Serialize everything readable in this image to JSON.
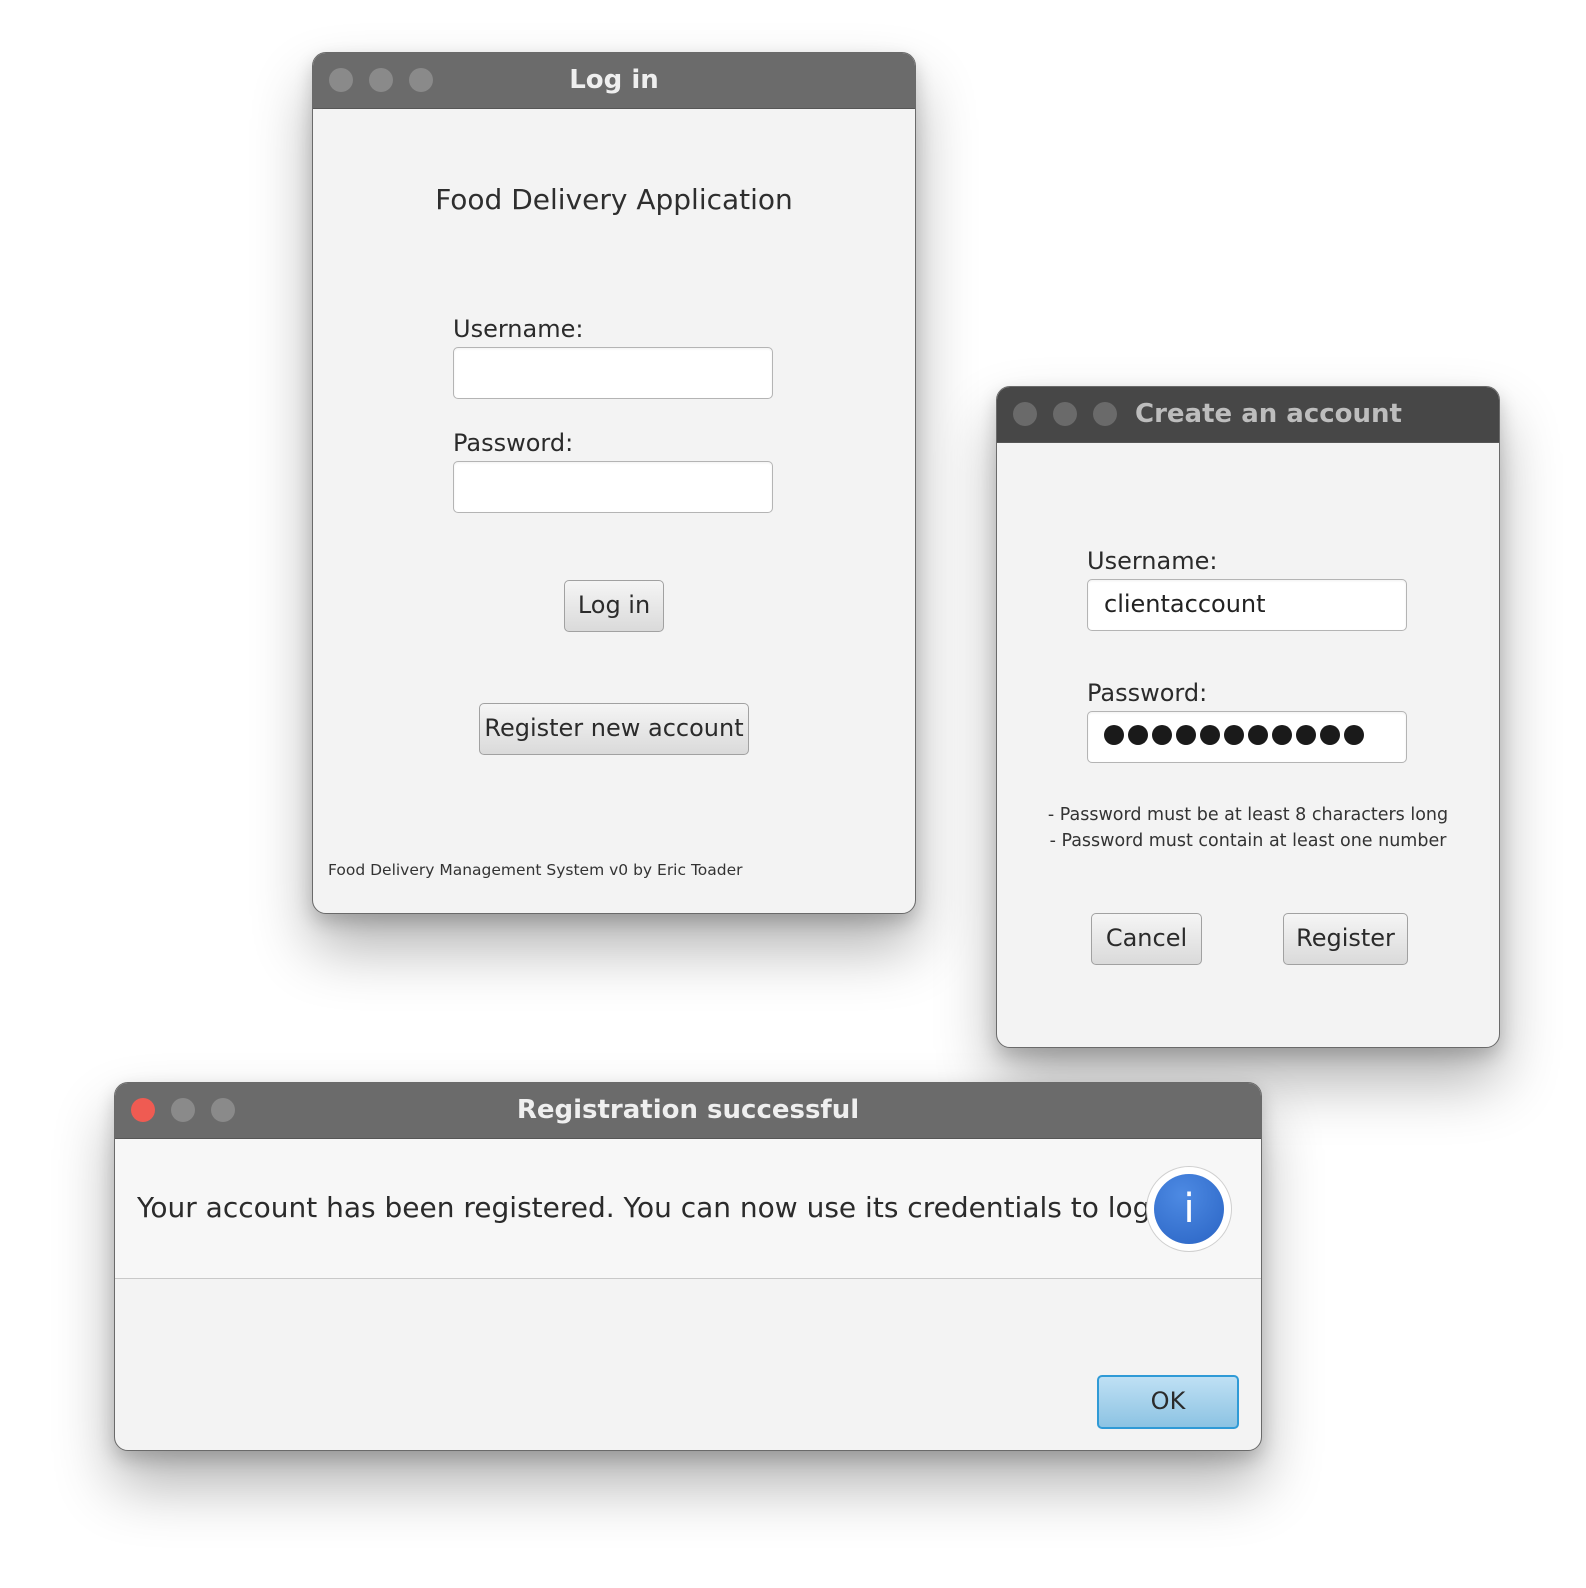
{
  "login_window": {
    "title": "Log in",
    "app_name": "Food Delivery Application",
    "username_label": "Username:",
    "username_value": "",
    "password_label": "Password:",
    "password_value": "",
    "login_button": "Log in",
    "register_button": "Register new account",
    "footer": "Food Delivery Management System v0 by Eric Toader"
  },
  "register_window": {
    "title": "Create an account",
    "username_label": "Username:",
    "username_value": "clientaccount",
    "password_label": "Password:",
    "password_mask_length": 11,
    "rule_1": "- Password must be at least 8 characters long",
    "rule_2": "- Password must contain at least one number",
    "cancel_button": "Cancel",
    "register_button": "Register"
  },
  "success_dialog": {
    "title": "Registration successful",
    "message": "Your account has been registered. You can now use its credentials to log in.",
    "info_glyph": "i",
    "ok_button": "OK"
  },
  "colors": {
    "close_button_active": "#ef5b52",
    "info_icon": "#2f6fd0",
    "default_button_border": "#2f9ad6"
  }
}
